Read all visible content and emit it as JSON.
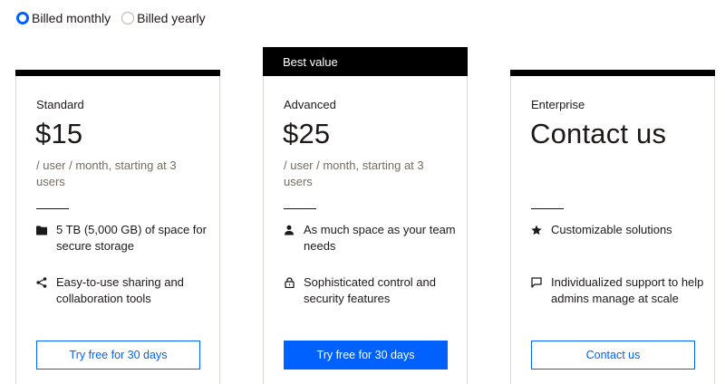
{
  "billing": {
    "options": [
      {
        "label": "Billed monthly",
        "selected": true
      },
      {
        "label": "Billed yearly",
        "selected": false
      }
    ]
  },
  "colors": {
    "accent": "#0061fe",
    "text": "#1e1919",
    "muted": "#736c64",
    "border": "#dcd9d4"
  },
  "plans": [
    {
      "name": "Standard",
      "price": "$15",
      "note": "/ user / month, starting at 3 users",
      "features": [
        {
          "icon": "folder-icon",
          "text": "5 TB (5,000 GB) of space for secure storage"
        },
        {
          "icon": "share-icon",
          "text": "Easy-to-use sharing and collaboration tools"
        }
      ],
      "cta": "Try free for 30 days"
    },
    {
      "badge": "Best value",
      "name": "Advanced",
      "price": "$25",
      "note": "/ user / month, starting at 3 users",
      "features": [
        {
          "icon": "person-icon",
          "text": "As much space as your team needs"
        },
        {
          "icon": "lock-icon",
          "text": "Sophisticated control and security features"
        }
      ],
      "cta": "Try free for 30 days"
    },
    {
      "name": "Enterprise",
      "price": "Contact us",
      "note": "",
      "features": [
        {
          "icon": "star-icon",
          "text": "Customizable solutions"
        },
        {
          "icon": "chat-icon",
          "text": "Individualized support to help admins manage at scale"
        }
      ],
      "cta": "Contact us"
    }
  ]
}
